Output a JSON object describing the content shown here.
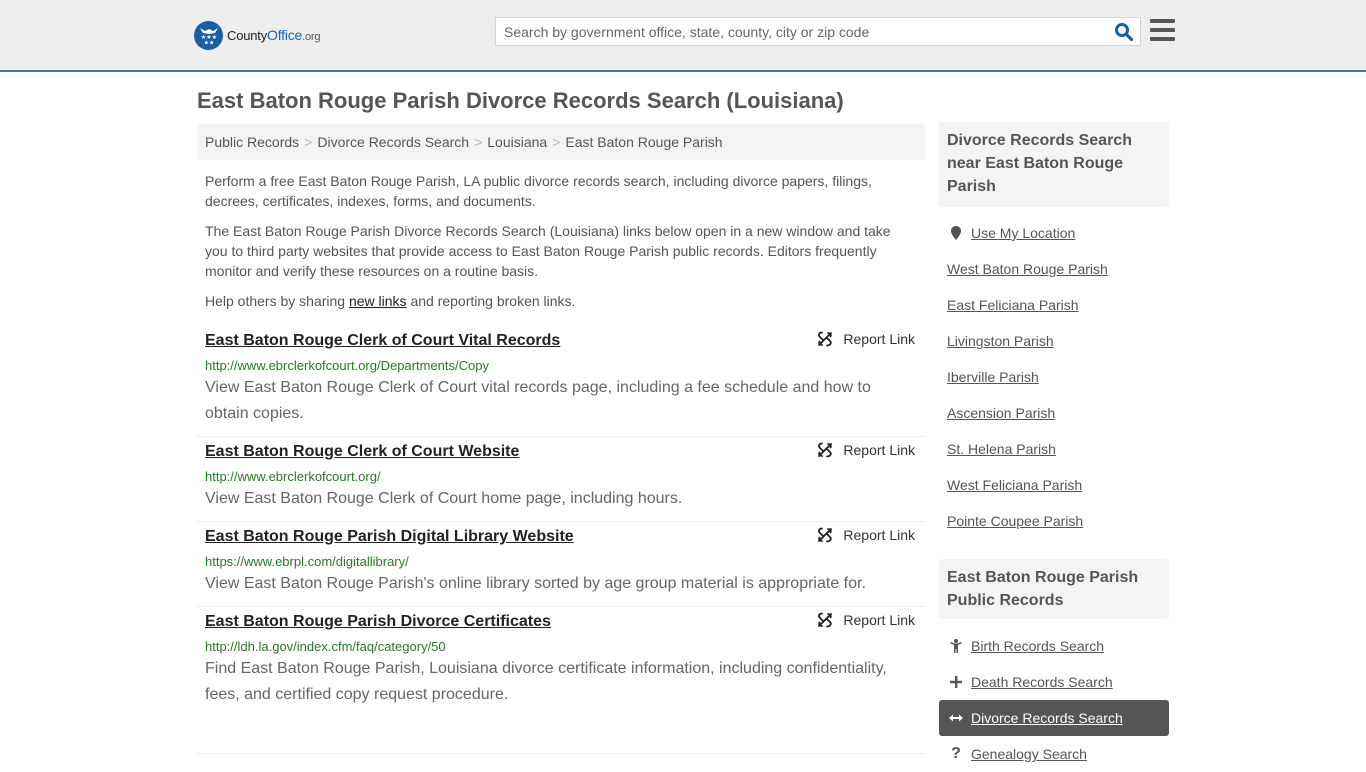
{
  "header": {
    "logo": {
      "name": "County",
      "highlight": "Office",
      "suffix": ".org"
    },
    "search": {
      "placeholder": "Search by government office, state, county, city or zip code",
      "value": ""
    },
    "colors": {
      "brand": "#1a5ea6",
      "accent_border": "#3f79a8"
    }
  },
  "page": {
    "title": "East Baton Rouge Parish Divorce Records Search (Louisiana)",
    "breadcrumb": [
      "Public Records",
      "Divorce Records Search",
      "Louisiana",
      "East Baton Rouge Parish"
    ],
    "intro": {
      "p1": "Perform a free East Baton Rouge Parish, LA public divorce records search, including divorce papers, filings, decrees, certificates, indexes, forms, and documents.",
      "p2": "The East Baton Rouge Parish Divorce Records Search (Louisiana) links below open in a new window and take you to third party websites that provide access to East Baton Rouge Parish public records. Editors frequently monitor and verify these resources on a routine basis.",
      "p3_before": "Help others by sharing ",
      "p3_link": "new links",
      "p3_after": " and reporting broken links."
    },
    "report_label": "Report Link",
    "results": [
      {
        "title": "East Baton Rouge Clerk of Court Vital Records",
        "url": "http://www.ebrclerkofcourt.org/Departments/Copy",
        "description": "View East Baton Rouge Clerk of Court vital records page, including a fee schedule and how to obtain copies."
      },
      {
        "title": "East Baton Rouge Clerk of Court Website",
        "url": "http://www.ebrclerkofcourt.org/",
        "description": "View East Baton Rouge Clerk of Court home page, including hours."
      },
      {
        "title": "East Baton Rouge Parish Digital Library Website",
        "url": "https://www.ebrpl.com/digitallibrary/",
        "description": "View East Baton Rouge Parish's online library sorted by age group material is appropriate for."
      },
      {
        "title": "East Baton Rouge Parish Divorce Certificates",
        "url": "http://ldh.la.gov/index.cfm/faq/category/50",
        "description": "Find East Baton Rouge Parish, Louisiana divorce certificate information, including confidentiality, fees, and certified copy request procedure."
      }
    ]
  },
  "sidebar": {
    "nearby_heading": "Divorce Records Search near East Baton Rouge Parish",
    "use_location": "Use My Location",
    "nearby": [
      "West Baton Rouge Parish",
      "East Feliciana Parish",
      "Livingston Parish",
      "Iberville Parish",
      "Ascension Parish",
      "St. Helena Parish",
      "West Feliciana Parish",
      "Pointe Coupee Parish"
    ],
    "records_heading": "East Baton Rouge Parish Public Records",
    "records": [
      {
        "label": "Birth Records Search",
        "icon": "child-icon",
        "active": false
      },
      {
        "label": "Death Records Search",
        "icon": "plus-icon",
        "active": false
      },
      {
        "label": "Divorce Records Search",
        "icon": "arrows-horizontal-icon",
        "active": true
      },
      {
        "label": "Genealogy Search",
        "icon": "question-icon",
        "active": false
      }
    ]
  }
}
